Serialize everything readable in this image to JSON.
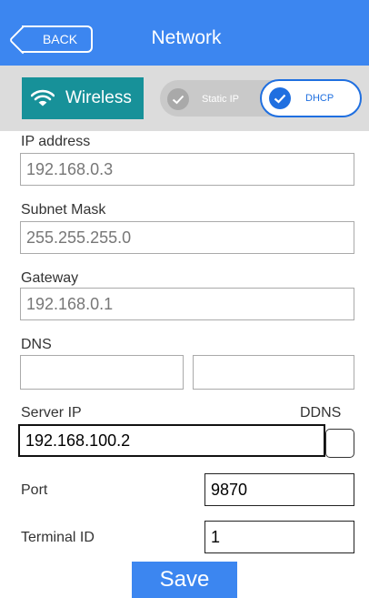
{
  "header": {
    "back_label": "BACK",
    "title": "Network",
    "color": "#3c86f0"
  },
  "mode_bar": {
    "wireless_label": "Wireless",
    "wireless_icon": "wifi-icon",
    "static_label": "Static IP",
    "dhcp_label": "DHCP",
    "selected": "DHCP",
    "accent": "#1f6fe0",
    "wireless_color": "#179199"
  },
  "fields": {
    "ip_label": "IP address",
    "ip_value": "192.168.0.3",
    "mask_label": "Subnet Mask",
    "mask_value": "255.255.255.0",
    "gateway_label": "Gateway",
    "gateway_value": "192.168.0.1",
    "dns_label": "DNS",
    "dns1_value": "",
    "dns2_value": "",
    "server_label": "Server IP",
    "ddns_label": "DDNS",
    "server_value": "192.168.100.2",
    "ddns_checked": false,
    "port_label": "Port",
    "port_value": "9870",
    "terminal_label": "Terminal ID",
    "terminal_value": "1"
  },
  "save_label": "Save"
}
